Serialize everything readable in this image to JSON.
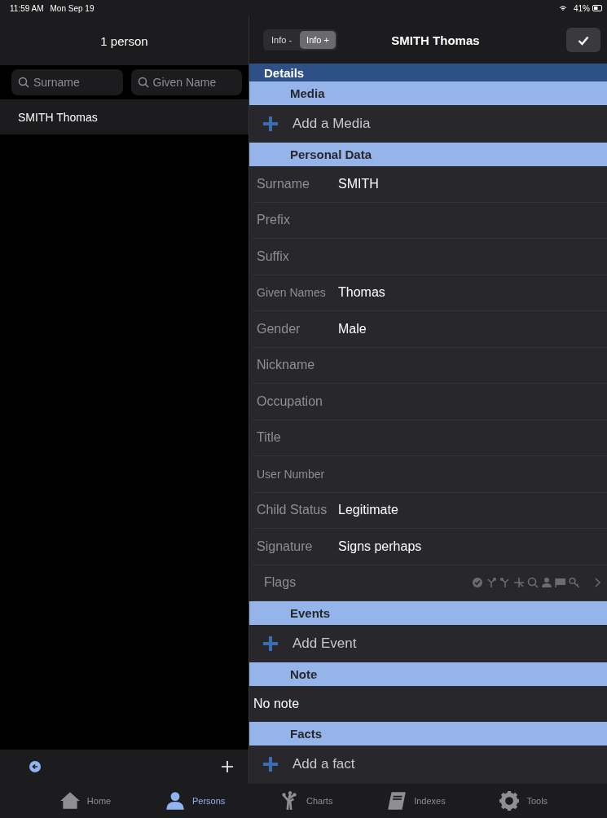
{
  "status_bar": {
    "time": "11:59 AM",
    "date": "Mon Sep 19",
    "battery": "41%"
  },
  "list_panel": {
    "title": "1 person",
    "search_fields": [
      {
        "placeholder": "Surname"
      },
      {
        "placeholder": "Given Name"
      }
    ],
    "items": [
      {
        "label": "SMITH Thomas",
        "selected": true
      }
    ]
  },
  "detail_panel": {
    "title": "SMITH Thomas",
    "segments": [
      {
        "label": "Info -",
        "selected": false
      },
      {
        "label": "Info +",
        "selected": true
      }
    ],
    "banner": "Details",
    "sections": [
      {
        "title": "Media",
        "rows": [
          {
            "kind": "action",
            "label": "Add a Media"
          }
        ]
      },
      {
        "title": "Personal Data",
        "rows": [
          {
            "kind": "field",
            "label": "Surname",
            "value": "SMITH"
          },
          {
            "kind": "field",
            "label": "Prefix"
          },
          {
            "kind": "field",
            "label": "Suffix"
          },
          {
            "kind": "field",
            "label": "Given Names",
            "value": "Thomas"
          },
          {
            "kind": "field",
            "label": "Gender",
            "value": "Male"
          },
          {
            "kind": "field",
            "label": "Nickname"
          },
          {
            "kind": "field",
            "label": "Occupation"
          },
          {
            "kind": "field",
            "label": "Title"
          },
          {
            "kind": "field",
            "label": "User Number"
          },
          {
            "kind": "field",
            "label": "Child Status",
            "value": "Legitimate"
          },
          {
            "kind": "field",
            "label": "Signature",
            "value": "Signs perhaps"
          },
          {
            "kind": "flags",
            "label": "Flags"
          }
        ]
      },
      {
        "title": "Events",
        "rows": [
          {
            "kind": "action",
            "label": "Add Event"
          }
        ]
      },
      {
        "title": "Note",
        "rows": [
          {
            "kind": "text",
            "label": "No note"
          }
        ]
      },
      {
        "title": "Facts",
        "rows": [
          {
            "kind": "action",
            "label": "Add a fact"
          }
        ]
      }
    ]
  },
  "tab_bar": [
    {
      "label": "Home",
      "selected": false
    },
    {
      "label": "Persons",
      "selected": true
    },
    {
      "label": "Charts",
      "selected": false
    },
    {
      "label": "Indexes",
      "selected": false
    },
    {
      "label": "Tools",
      "selected": false
    }
  ]
}
